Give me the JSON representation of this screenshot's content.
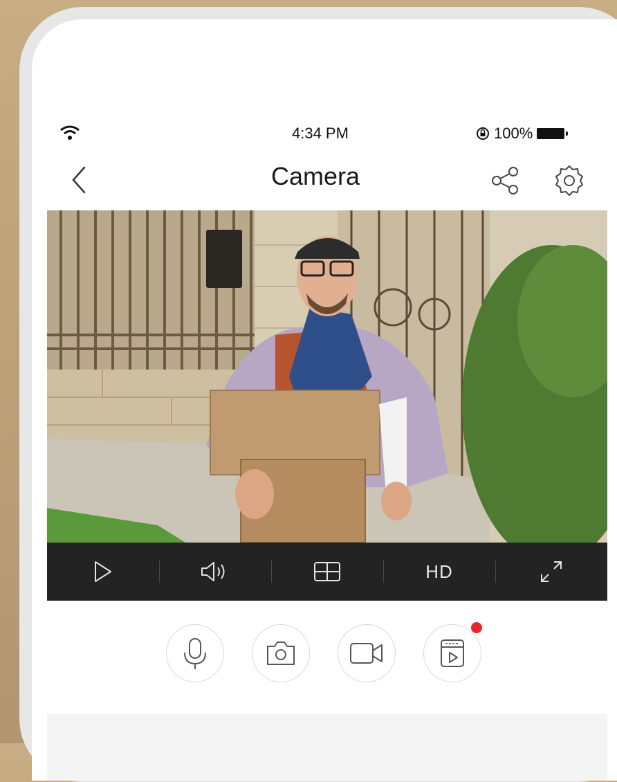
{
  "status_bar": {
    "time": "4:34 PM",
    "battery_text": "100%",
    "icons": [
      "wifi-icon",
      "orientation-lock-icon",
      "battery-icon"
    ]
  },
  "nav": {
    "title": "Camera",
    "icons": [
      "back-icon",
      "share-icon",
      "gear-icon"
    ]
  },
  "video_toolbar": {
    "items": [
      "play-icon",
      "volume-icon",
      "multiview-icon",
      "quality",
      "fullscreen-icon"
    ],
    "quality_label": "HD"
  },
  "actions": {
    "items": [
      "microphone-icon",
      "camera-snapshot-icon",
      "video-record-icon",
      "playback-icon"
    ],
    "notification_on": "playback"
  },
  "colors": {
    "toolbar_bg": "#232323",
    "notification_dot": "#e8262b",
    "background": "#c8ac84"
  }
}
